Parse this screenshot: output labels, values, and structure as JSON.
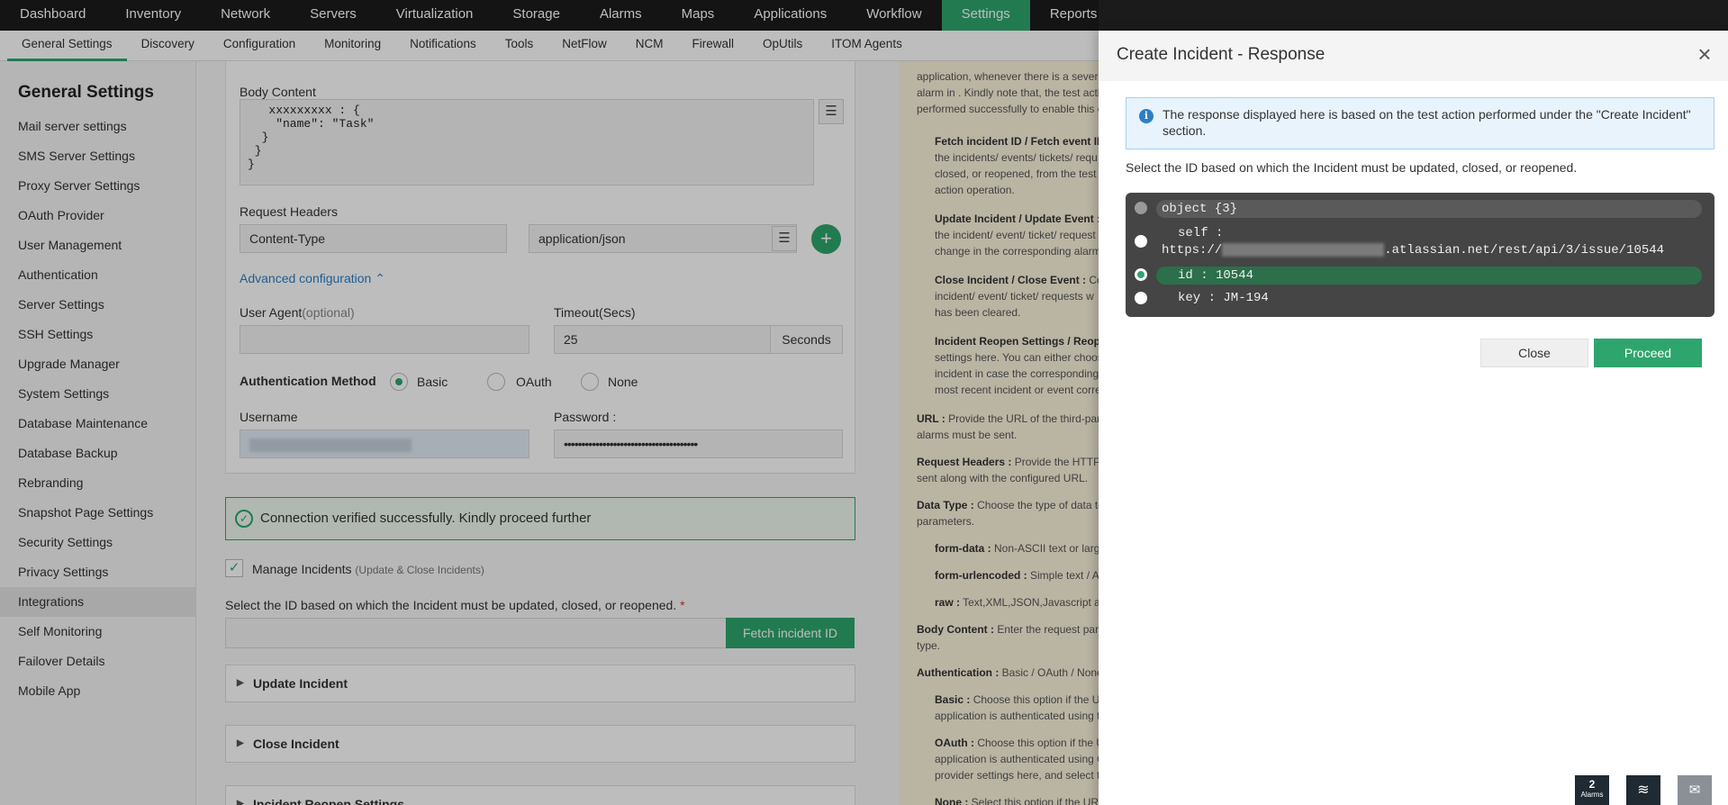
{
  "topnav": [
    "Dashboard",
    "Inventory",
    "Network",
    "Servers",
    "Virtualization",
    "Storage",
    "Alarms",
    "Maps",
    "Applications",
    "Workflow",
    "Settings",
    "Reports"
  ],
  "subnav": [
    "General Settings",
    "Discovery",
    "Configuration",
    "Monitoring",
    "Notifications",
    "Tools",
    "NetFlow",
    "NCM",
    "Firewall",
    "OpUtils",
    "ITOM Agents"
  ],
  "sidebar": {
    "title": "General Settings",
    "items": [
      "Mail server settings",
      "SMS Server Settings",
      "Proxy Server Settings",
      "OAuth Provider",
      "User Management",
      "Authentication",
      "Server Settings",
      "SSH Settings",
      "Upgrade Manager",
      "System Settings",
      "Database Maintenance",
      "Database Backup",
      "Rebranding",
      "Snapshot Page Settings",
      "Security Settings",
      "Privacy Settings",
      "Integrations",
      "Self Monitoring",
      "Failover Details",
      "Mobile App"
    ],
    "active": "Integrations"
  },
  "form": {
    "body_label": "Body Content",
    "body_text": "   xxxxxxxxx : {\n    \"name\": \"Task\"\n  }\n }\n}",
    "headers_label": "Request Headers",
    "header_key": "Content-Type",
    "header_value": "application/json",
    "advanced_label": "Advanced configuration",
    "user_agent_label": "User Agent",
    "user_agent_optional": "(optional)",
    "timeout_label": "Timeout(Secs)",
    "timeout_value": "25",
    "timeout_unit": "Seconds",
    "auth_label": "Authentication Method",
    "auth_options": [
      "Basic",
      "OAuth",
      "None"
    ],
    "username_label": "Username",
    "password_label": "Password :",
    "password_value": "••••••••••••••••••••••••••••••••••••••",
    "success_msg": "Connection verified successfully. Kindly proceed further",
    "manage_label": "Manage Incidents",
    "manage_sub": "(Update & Close Incidents)",
    "select_id_label": "Select the ID based on which the Incident must be updated, closed, or reopened.",
    "required_mark": "*",
    "fetch_label": "Fetch incident ID",
    "sections": [
      "Update Incident",
      "Close Incident",
      "Incident Reopen Settings"
    ]
  },
  "help": {
    "lines": [
      "application, whenever there is a severit",
      "alarm in . Kindly note that, the test acti",
      "performed successfully to enable this c"
    ],
    "fetch_title": "Fetch incident ID / Fetch event ID",
    "fetch_lines": [
      "the incidents/ events/ tickets/ requ",
      "closed, or reopened, from the test t",
      "action operation."
    ],
    "update_title": "Update Incident / Update Event :",
    "update_lines": [
      "the incident/ event/ ticket/ request",
      "change in the corresponding alarm"
    ],
    "close_title": "Close Incident / Close Event :",
    "close_tail": " Con",
    "close_lines": [
      "incident/ event/ ticket/ requests w",
      "has been cleared."
    ],
    "reopen_title": "Incident Reopen Settings / Reopen",
    "reopen_lines": [
      "settings here. You can either choos",
      "incident in case the corresponding",
      "most recent incident or event corre"
    ],
    "url_title": "URL :",
    "url_text": " Provide the URL of the third-par",
    "url_line2": "alarms must be sent.",
    "rh_title": "Request Headers :",
    "rh_text": " Provide the HTTP r",
    "rh_line2": "sent along with the configured URL.",
    "dt_title": "Data Type :",
    "dt_text": " Choose the type of data to",
    "dt_line2": "parameters.",
    "fd_title": "form-data :",
    "fd_text": " Non-ASCII text or large",
    "fu_title": "form-urlencoded :",
    "fu_text": " Simple text / AS",
    "raw_title": "raw :",
    "raw_text": " Text,XML,JSON,Javascript an",
    "bc_title": "Body Content :",
    "bc_text": " Enter the request para",
    "bc_line2": "type.",
    "auth_title": "Authentication :",
    "auth_text": " Basic / OAuth / None",
    "basic_title": "Basic :",
    "basic_text": " Choose this option if the UR",
    "basic_line2": "application is authenticated using t",
    "oauth_title": "OAuth :",
    "oauth_text": " Choose this option if the U",
    "oauth_line2": "application is authenticated using O",
    "oauth_line3": "provider settings here, and select t",
    "none_title": "None :",
    "none_text": " Select this option if the URL"
  },
  "dialog": {
    "title": "Create Incident - Response",
    "info": "The response displayed here is based on the test action performed under the \"Create Incident\" section.",
    "instruction": "Select the ID based on which the Incident must be updated, closed, or reopened.",
    "json": {
      "root": "object {3}",
      "self_key": "self :",
      "self_prefix": "https://",
      "self_suffix": ".atlassian.net/rest/api/3/issue/10544",
      "id": "id : 10544",
      "key": "key : JM-194"
    },
    "selected": "id",
    "close_label": "Close",
    "proceed_label": "Proceed"
  },
  "widgets": {
    "alarms_count": "2",
    "alarms_label": "Alarms"
  },
  "colors": {
    "accent": "#2fa56e",
    "topnav_bg": "#1b1b1b",
    "help_bg": "#fbf3dc",
    "info_bg": "#e8f3fc",
    "json_bg": "#454545"
  }
}
